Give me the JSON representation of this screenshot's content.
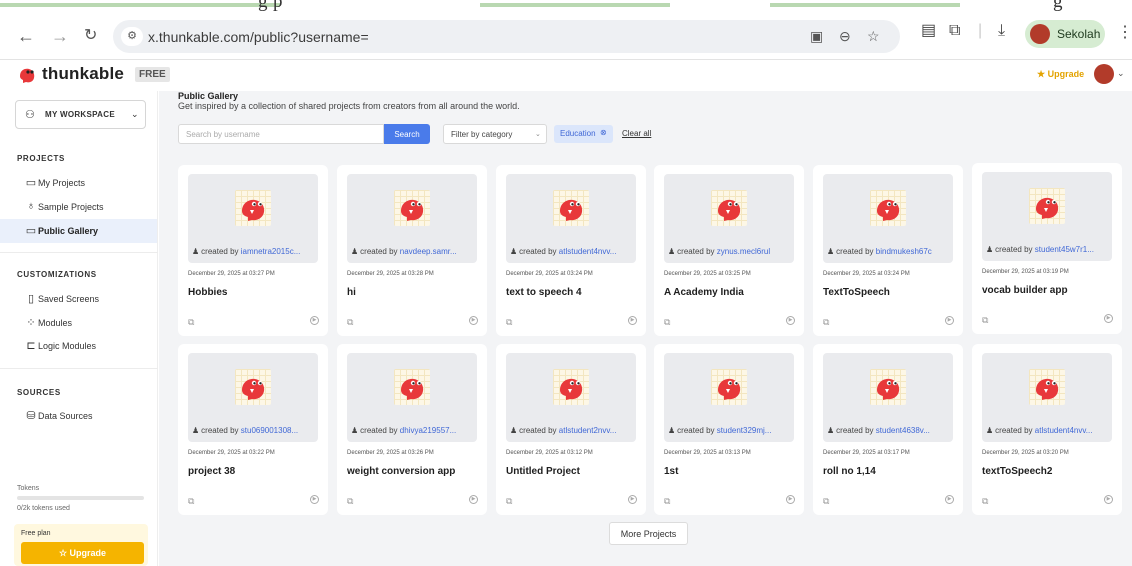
{
  "top_strip_text": "g                                    p",
  "top_strip_text_right": "g",
  "browser": {
    "url": "x.thunkable.com/public?username=",
    "profile_name": "Sekolah"
  },
  "app": {
    "brand": "thunkable",
    "plan_badge": "FREE",
    "upgrade_link": "★ Upgrade",
    "colors": {
      "accent": "#4a7bea",
      "upgrade": "#f5b400",
      "mascot": "#e8383a"
    }
  },
  "sidebar": {
    "workspace_label": "MY WORKSPACE",
    "projects_title": "PROJECTS",
    "projects_items": [
      {
        "label": "My Projects",
        "icon": "file-icon"
      },
      {
        "label": "Sample Projects",
        "icon": "bulb-icon"
      },
      {
        "label": "Public Gallery",
        "icon": "gallery-icon"
      }
    ],
    "customizations_title": "CUSTOMIZATIONS",
    "customizations_items": [
      {
        "label": "Saved Screens",
        "icon": "phone-icon"
      },
      {
        "label": "Modules",
        "icon": "modules-icon"
      },
      {
        "label": "Logic Modules",
        "icon": "logic-icon"
      }
    ],
    "sources_title": "SOURCES",
    "sources_items": [
      {
        "label": "Data Sources",
        "icon": "database-icon"
      }
    ],
    "tokens_label": "Tokens",
    "tokens_used": "0/2k tokens used",
    "tokens_fraction": 0,
    "plan_label": "Free plan",
    "upgrade_button": "Upgrade"
  },
  "main": {
    "title": "Public Gallery",
    "subtitle": "Get inspired by a collection of shared projects from creators from all around the world.",
    "search_placeholder": "Search by username",
    "search_button": "Search",
    "filter_label": "Filter by category",
    "active_filter": "Education",
    "clear_all": "Clear all",
    "more_button": "More Projects",
    "created_by_prefix": "created by",
    "projects": [
      {
        "creator": "iamnetra2015c...",
        "date": "December 29, 2025 at 03:27 PM",
        "title": "Hobbies"
      },
      {
        "creator": "navdeep.samr...",
        "date": "December 29, 2025 at 03:28 PM",
        "title": "hi"
      },
      {
        "creator": "atlstudent4nvv...",
        "date": "December 29, 2025 at 03:24 PM",
        "title": "text to speech 4"
      },
      {
        "creator": "zynus.mecl6rul",
        "date": "December 29, 2025 at 03:25 PM",
        "title": "A Academy India"
      },
      {
        "creator": "bindmukesh67c",
        "date": "December 29, 2025 at 03:24 PM",
        "title": "TextToSpeech"
      },
      {
        "creator": "student45w7r1...",
        "date": "December 29, 2025 at 03:19 PM",
        "title": "vocab builder app"
      },
      {
        "creator": "stu069001308...",
        "date": "December 29, 2025 at 03:22 PM",
        "title": "project 38"
      },
      {
        "creator": "dhivya219557...",
        "date": "December 29, 2025 at 03:26 PM",
        "title": "weight conversion app"
      },
      {
        "creator": "atlstudent2nvv...",
        "date": "December 29, 2025 at 03:12 PM",
        "title": "Untitled Project"
      },
      {
        "creator": "student329mj...",
        "date": "December 29, 2025 at 03:13 PM",
        "title": "1st"
      },
      {
        "creator": "student4638v...",
        "date": "December 29, 2025 at 03:17 PM",
        "title": "roll no 1,14"
      },
      {
        "creator": "atlstudent4nvv...",
        "date": "December 29, 2025 at 03:20 PM",
        "title": "textToSpeech2"
      }
    ]
  }
}
